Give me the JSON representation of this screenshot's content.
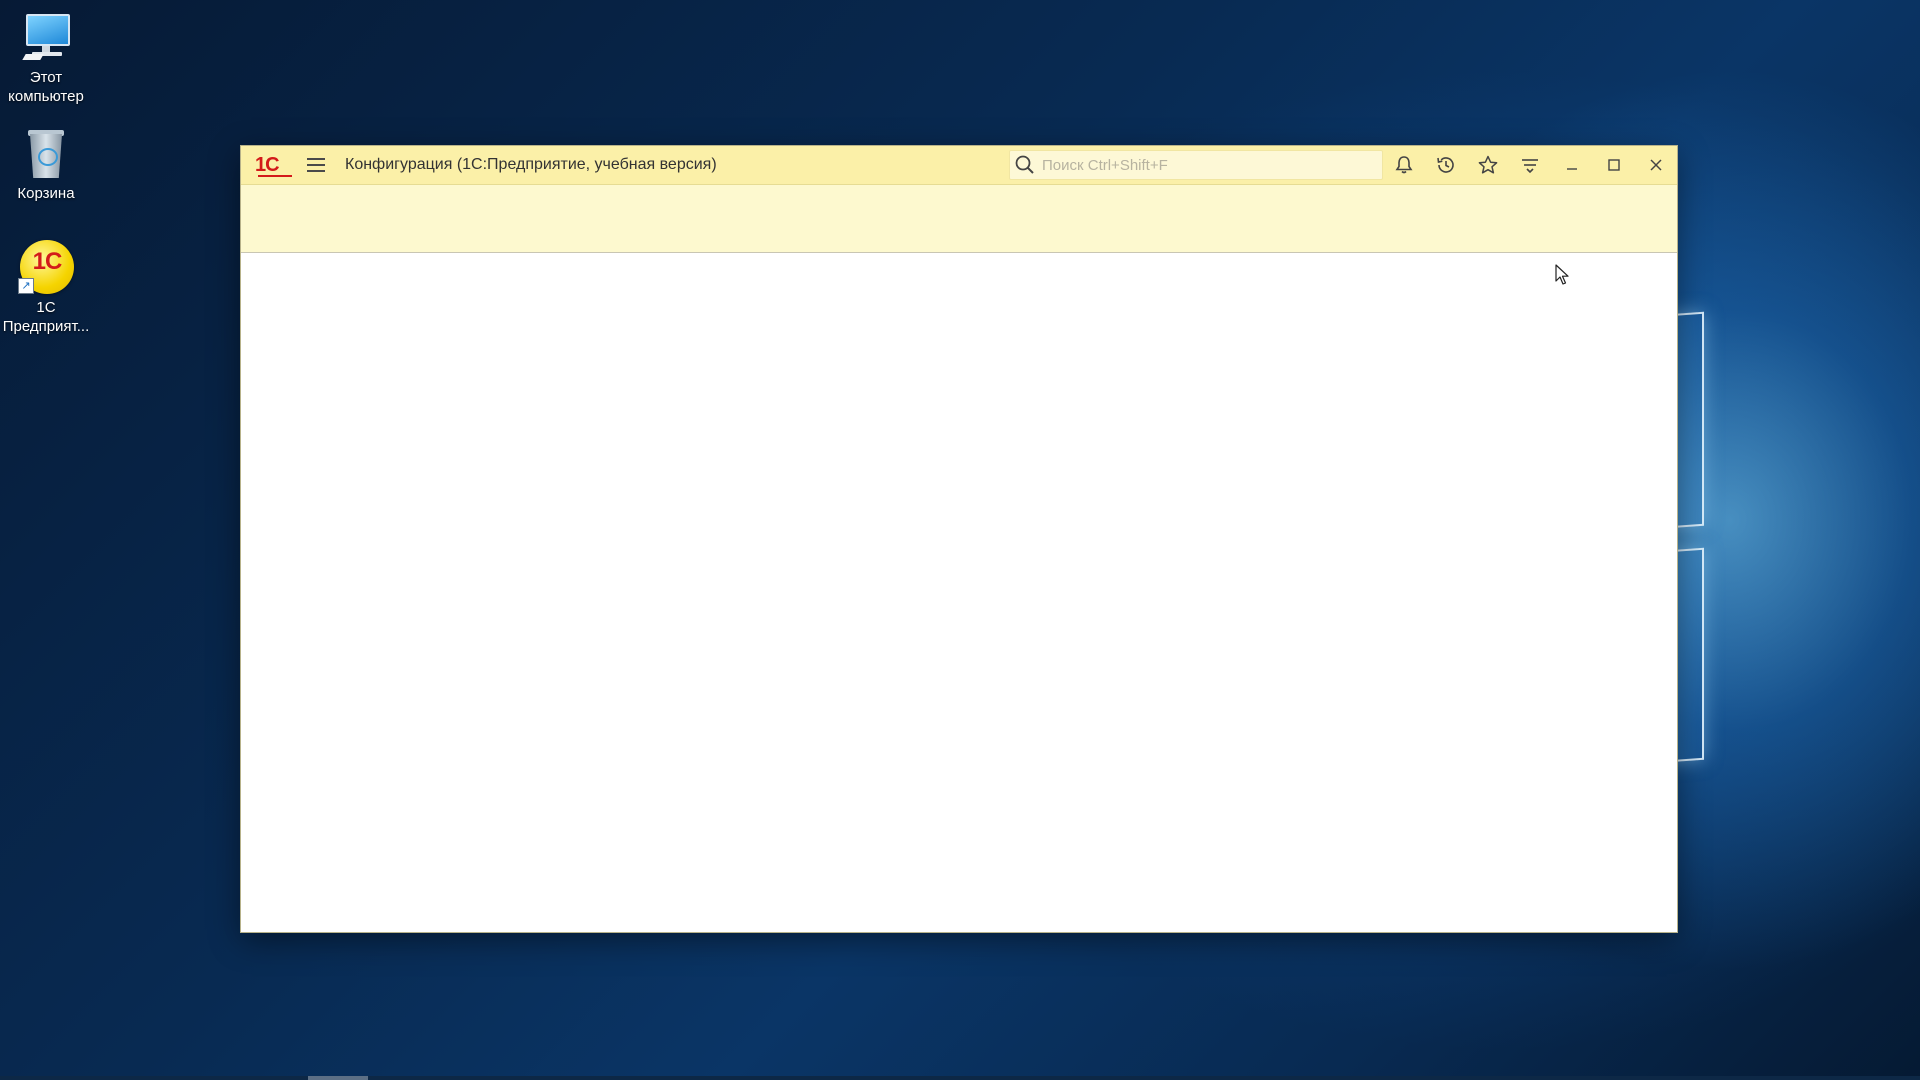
{
  "desktop": {
    "icons": [
      {
        "label_line1": "Этот",
        "label_line2": "компьютер",
        "icon": "this-pc-icon"
      },
      {
        "label_line1": "Корзина",
        "label_line2": "",
        "icon": "recycle-bin-icon"
      },
      {
        "label_line1": "1С",
        "label_line2": "Предприят...",
        "icon": "1c-enterprise-icon"
      }
    ],
    "onec_glyph_text": "1С"
  },
  "window": {
    "logo_text": "1С",
    "title": "Конфигурация  (1С:Предприятие, учебная версия)",
    "search": {
      "placeholder": "Поиск Ctrl+Shift+F",
      "value": ""
    },
    "toolbar_icons": [
      "bell-icon",
      "history-icon",
      "star-icon",
      "more-menu-icon",
      "minimize-icon",
      "maximize-icon",
      "close-icon"
    ]
  },
  "colors": {
    "titlebar": "#fbf0a8",
    "command_panel": "#fdf9cf",
    "logo_red": "#d31a1a"
  }
}
